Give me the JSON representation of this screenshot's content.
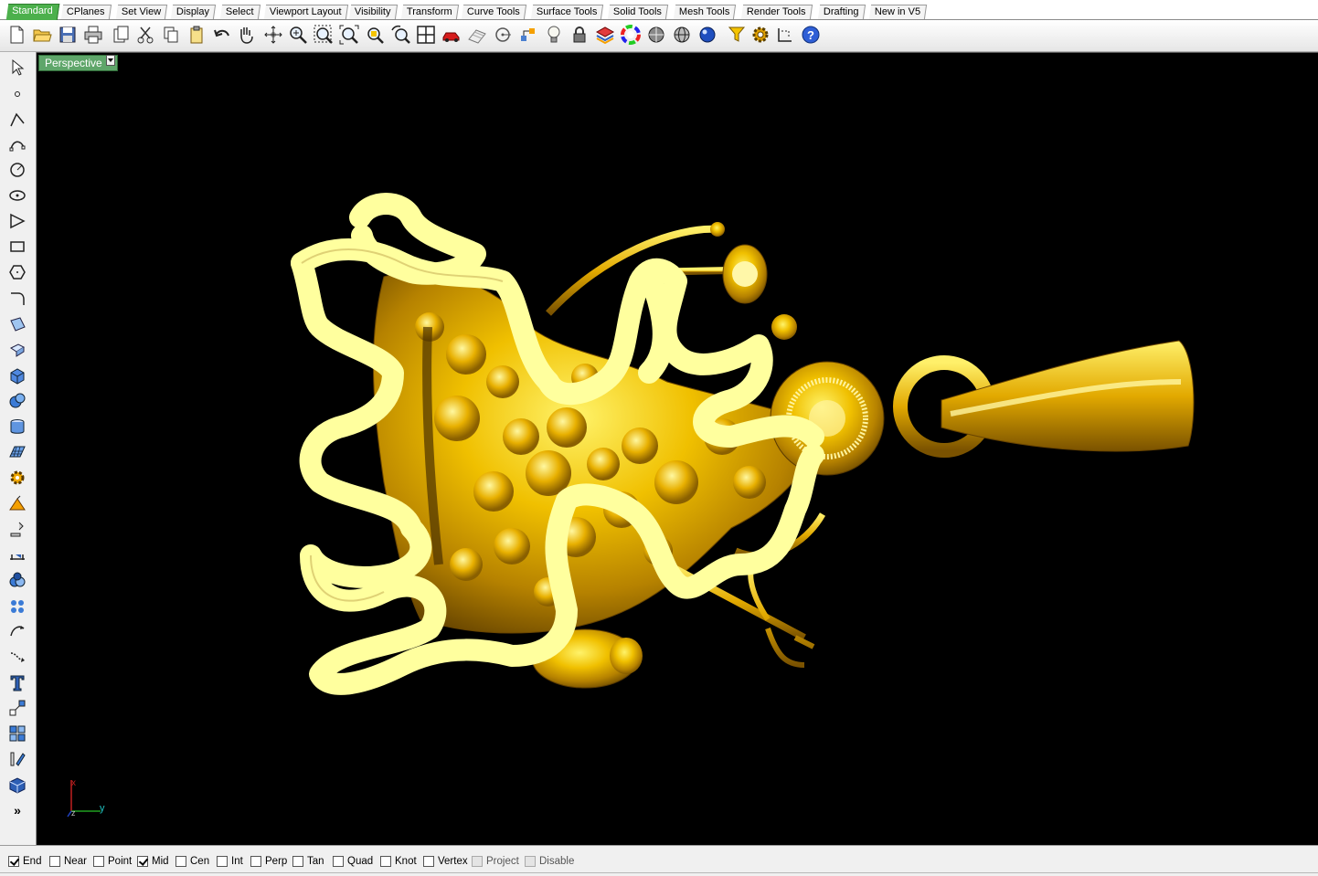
{
  "tabs": [
    {
      "label": "Standard",
      "active": true
    },
    {
      "label": "CPlanes"
    },
    {
      "label": "Set View"
    },
    {
      "label": "Display"
    },
    {
      "label": "Select"
    },
    {
      "label": "Viewport Layout"
    },
    {
      "label": "Visibility"
    },
    {
      "label": "Transform"
    },
    {
      "label": "Curve Tools"
    },
    {
      "label": "Surface Tools"
    },
    {
      "label": "Solid Tools"
    },
    {
      "label": "Mesh Tools"
    },
    {
      "label": "Render Tools"
    },
    {
      "label": "Drafting"
    },
    {
      "label": "New in V5"
    }
  ],
  "toolbar_icons": [
    "new-file-icon",
    "open-folder-icon",
    "save-icon",
    "print-icon",
    "paste-icon",
    "cut-icon",
    "copy-icon",
    "clipboard-icon",
    "undo-icon",
    "pan-hand-icon",
    "rotate-view-icon",
    "zoom-dynamic-icon",
    "zoom-window-icon",
    "zoom-extents-icon",
    "zoom-selected-icon",
    "undo-view-icon",
    "four-viewports-icon",
    "car-render-icon",
    "grid-options-icon",
    "snap-circle-icon",
    "cplane-icon",
    "light-bulb-icon",
    "lock-icon",
    "layer-icon",
    "color-wheel-icon",
    "shaded-sphere-icon",
    "wire-sphere-icon",
    "render-sphere-icon",
    "filter-icon",
    "options-gear-icon",
    "dimension-icon",
    "help-icon"
  ],
  "viewport": {
    "label": "Perspective",
    "axis": {
      "x": "x",
      "y": "y",
      "z": "z"
    },
    "colors": {
      "background": "#000000",
      "gold": "#e8b400",
      "highlight": "#ffffa0"
    }
  },
  "osnaps": [
    {
      "label": "End",
      "checked": true
    },
    {
      "label": "Near",
      "checked": false
    },
    {
      "label": "Point",
      "checked": false
    },
    {
      "label": "Mid",
      "checked": true
    },
    {
      "label": "Cen",
      "checked": false
    },
    {
      "label": "Int",
      "checked": false
    },
    {
      "label": "Perp",
      "checked": false
    },
    {
      "label": "Tan",
      "checked": false
    },
    {
      "label": "Quad",
      "checked": false
    },
    {
      "label": "Knot",
      "checked": false
    },
    {
      "label": "Vertex",
      "checked": false
    },
    {
      "label": "Project",
      "checked": false,
      "disabled": true
    },
    {
      "label": "Disable",
      "checked": false,
      "disabled": true
    }
  ]
}
